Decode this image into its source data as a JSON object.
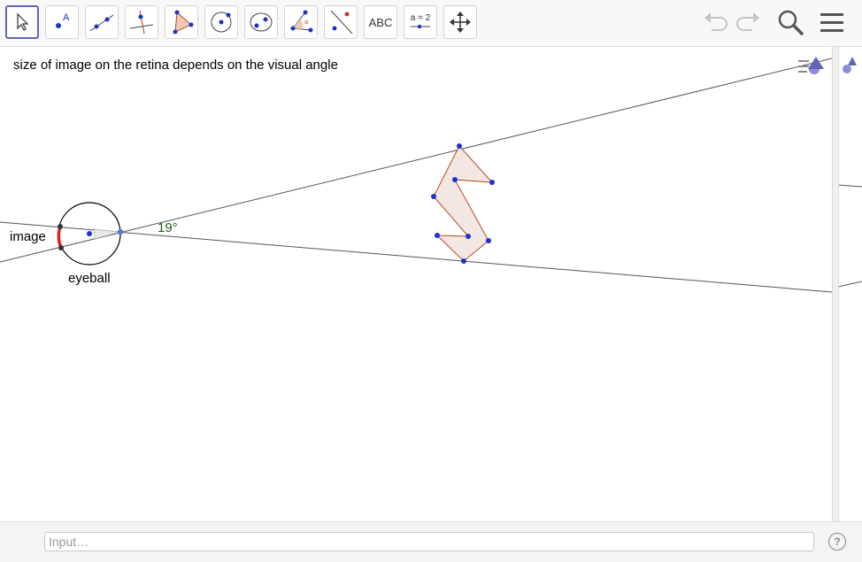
{
  "toolbar": {
    "tools": [
      {
        "name": "move-tool",
        "active": true
      },
      {
        "name": "point-tool"
      },
      {
        "name": "line-tool"
      },
      {
        "name": "perpendicular-line-tool"
      },
      {
        "name": "polygon-tool"
      },
      {
        "name": "circle-center-point-tool"
      },
      {
        "name": "conic-tool"
      },
      {
        "name": "angle-tool"
      },
      {
        "name": "reflect-tool"
      },
      {
        "name": "text-tool",
        "label": "ABC"
      },
      {
        "name": "slider-tool",
        "label": "a = 2"
      },
      {
        "name": "move-graphics-view-tool"
      }
    ]
  },
  "graphics": {
    "caption": "size of image on the retina depends on the visual angle",
    "labels": {
      "image": "image",
      "eyeball": "eyeball",
      "angle": "19°"
    }
  },
  "colors": {
    "accent": "#6264b4",
    "point": "#1a33cc",
    "polygon_stroke": "#b24a20",
    "polygon_fill": "#f3e7e3",
    "image_arc": "#e02020",
    "angle_text": "#1a5e1a"
  },
  "input": {
    "placeholder": "Input…"
  },
  "help": {
    "label": "?"
  }
}
